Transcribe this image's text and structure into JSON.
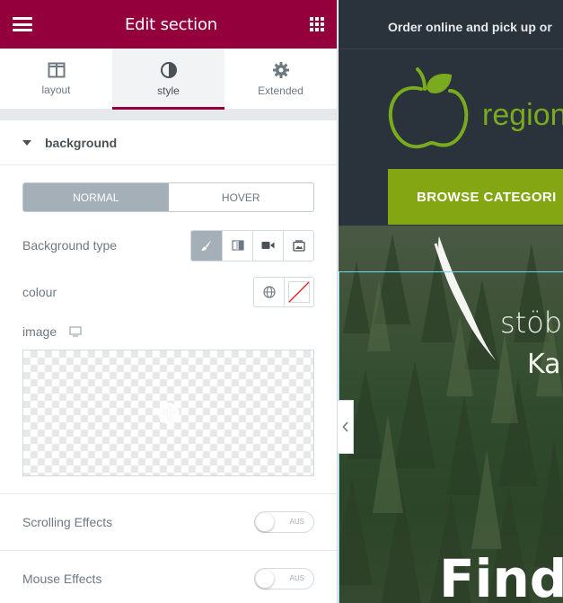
{
  "panel": {
    "title": "Edit section",
    "tabs": [
      {
        "label": "layout",
        "icon": "columns-icon",
        "active": false
      },
      {
        "label": "style",
        "icon": "half-circle-icon",
        "active": true
      },
      {
        "label": "Extended",
        "icon": "gear-icon",
        "active": false
      }
    ],
    "section": {
      "label": "background",
      "expanded": true
    },
    "state_toggle": {
      "normal": "NORMAL",
      "hover": "HOVER",
      "active": "normal"
    },
    "background_type": {
      "label": "Background type",
      "options": [
        "brush-icon",
        "gradient-icon",
        "video-icon",
        "slideshow-icon"
      ],
      "active": "brush-icon"
    },
    "colour": {
      "label": "colour",
      "icons": [
        "globe-icon",
        "empty-swatch-icon"
      ]
    },
    "image": {
      "label": "image",
      "device_icon": "desktop-icon"
    },
    "effects": [
      {
        "label": "Scrolling Effects",
        "toggle_text": "AUS"
      },
      {
        "label": "Mouse Effects",
        "toggle_text": "AUS"
      }
    ]
  },
  "preview": {
    "top_bar_text": "Order online and pick up or",
    "logo_text": "region",
    "browse_button": "BROWSE CATEGORI",
    "hero_word_1": "stöb",
    "hero_word_2": "Ka",
    "hero_headline": "Find"
  },
  "colors": {
    "brand": "#93003c",
    "accent_green": "#84a613",
    "selection_blue": "#71d7f7"
  }
}
